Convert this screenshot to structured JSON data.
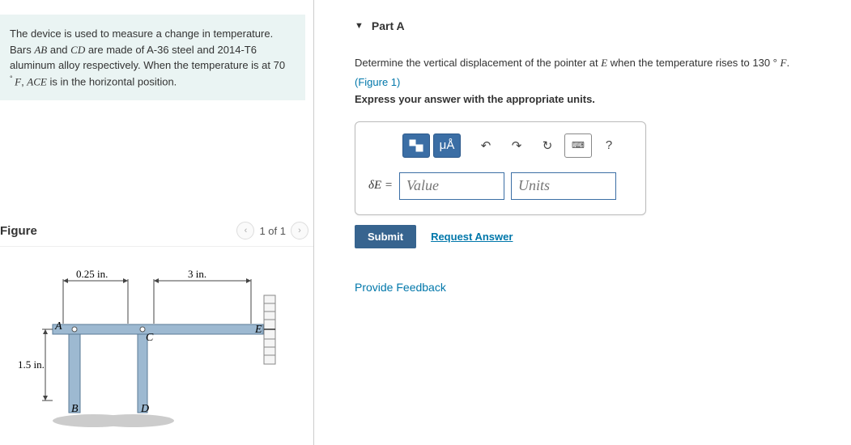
{
  "problem": {
    "line1": "The device is used to measure a change in temperature.",
    "line2a": "Bars ",
    "bar1": "AB",
    "line2b": " and ",
    "bar2": "CD",
    "line2c": " are made of A-36 steel and 2014-T6",
    "line3": "aluminum alloy respectively. When the temperature is at 70",
    "line4a": "° ",
    "unitF": "F",
    "line4b": ", ",
    "ace": "ACE",
    "line4c": " is in the horizontal position."
  },
  "figure": {
    "title": "Figure",
    "pager": "1 of 1",
    "dim_ab": "0.25 in.",
    "dim_ce": "3 in.",
    "dim_h": "1.5 in.",
    "ptA": "A",
    "ptB": "B",
    "ptC": "C",
    "ptD": "D",
    "ptE": "E"
  },
  "part": {
    "header": "Part A",
    "q1": "Determine the vertical displacement of the pointer at ",
    "qE": "E",
    "q2": " when the temperature rises to 130 ° ",
    "qF": "F",
    "q3": ".",
    "figlink": "(Figure 1)",
    "instruction": "Express your answer with the appropriate units.",
    "units_btn": "μÅ",
    "help_btn": "?",
    "deltaE": "δE =",
    "value_ph": "Value",
    "units_ph": "Units",
    "submit": "Submit",
    "request": "Request Answer"
  },
  "feedback": "Provide Feedback"
}
